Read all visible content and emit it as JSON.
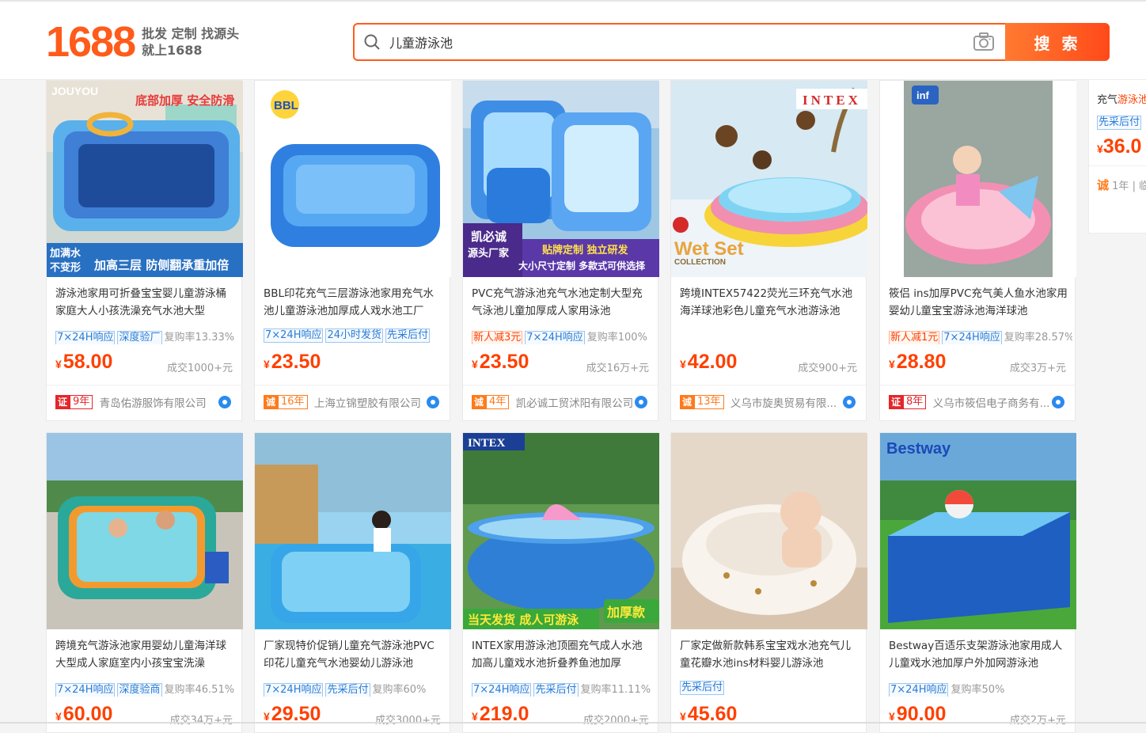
{
  "header": {
    "logo_number": "1688",
    "slogan_line1": "批发 定制 找源头",
    "slogan_line2": "就上1688",
    "search_value": "儿童游泳池",
    "search_button": "搜 索"
  },
  "products": [
    {
      "title": "游泳池家用可折叠宝宝婴儿童游泳桶家庭大人小孩洗澡充气水池大型",
      "tags": [
        {
          "text": "7×24H响应",
          "type": "blue"
        },
        {
          "text": "深度验厂",
          "type": "blue"
        }
      ],
      "repurchase": "复购率13.33%",
      "price": "58.00",
      "sales": "成交1000+元",
      "badge_icon": "证",
      "badge_type": "red",
      "years": "9年",
      "shop": "青岛佑游服饰有限公司",
      "img": "pool-stones",
      "img_caption1": "加满水",
      "img_caption2": "不变形",
      "img_caption3": "加高三层 防侧翻承重加倍",
      "img_brand": "JOUYOU",
      "img_top": "底部加厚 安全防滑"
    },
    {
      "title": "BBL印花充气三层游泳池家用充气水池儿童游泳池加厚成人戏水池工厂",
      "tags": [
        {
          "text": "7×24H响应",
          "type": "blue"
        },
        {
          "text": "24小时发货",
          "type": "blue"
        },
        {
          "text": "先采后付",
          "type": "blue"
        }
      ],
      "repurchase": "",
      "price": "23.50",
      "sales": "",
      "badge_icon": "诚",
      "badge_type": "orange",
      "years": "16年",
      "shop": "上海立锦塑胶有限公司",
      "img": "pool-blue-white",
      "img_brand": "BBL"
    },
    {
      "title": "PVC充气游泳池充气水池定制大型充气泳池儿童加厚成人家用泳池",
      "tags": [
        {
          "text": "新人减3元",
          "type": "red"
        },
        {
          "text": "7×24H响应",
          "type": "blue"
        }
      ],
      "repurchase": "复购率100%",
      "price": "23.50",
      "sales": "成交16万+元",
      "badge_icon": "诚",
      "badge_type": "orange",
      "years": "4年",
      "shop": "凯必诚工贸沭阳有限公司",
      "img": "pool-stack",
      "img_caption1": "凯必诚",
      "img_caption2": "源头厂家",
      "img_caption3": "贴牌定制 独立研发",
      "img_caption4": "大小尺寸定制 多款式可供选择"
    },
    {
      "title": "跨境INTEX57422荧光三环充气水池海洋球池彩色儿童充气水池游泳池",
      "tags": [],
      "repurchase": "",
      "price": "42.00",
      "sales": "成交900+元",
      "badge_icon": "诚",
      "badge_type": "orange",
      "years": "13年",
      "shop": "义乌市旋奥贸易有限...",
      "img": "pool-rainbow",
      "img_brand": "INTEX",
      "img_caption1": "Wet Set",
      "img_caption2": "COLLECTION"
    },
    {
      "title": "筱侣 ins加厚PVC充气美人鱼水池家用婴幼儿童宝宝游泳池海洋球池",
      "tags": [
        {
          "text": "新人减1元",
          "type": "red"
        },
        {
          "text": "7×24H响应",
          "type": "blue"
        }
      ],
      "repurchase": "复购率28.57%",
      "price": "28.80",
      "sales": "成交3万+元",
      "badge_icon": "证",
      "badge_type": "red",
      "years": "8年",
      "shop": "义乌市筱侣电子商务有...",
      "img": "pool-pink",
      "img_brand": "inf"
    },
    {
      "title": "跨境充气游泳池家用婴幼儿童海洋球大型成人家庭室内小孩宝宝洗澡",
      "tags": [
        {
          "text": "7×24H响应",
          "type": "blue"
        },
        {
          "text": "深度验商",
          "type": "blue"
        }
      ],
      "repurchase": "复购率46.51%",
      "price": "60.00",
      "sales": "成交34万+元",
      "img": "pool-orange-green"
    },
    {
      "title": "厂家现特价促销儿童充气游泳池PVC印花儿童充气水池婴幼儿游泳池",
      "tags": [
        {
          "text": "7×24H响应",
          "type": "blue"
        },
        {
          "text": "先采后付",
          "type": "blue"
        }
      ],
      "repurchase": "复购率60%",
      "price": "29.50",
      "sales": "成交3000+元",
      "img": "pool-outdoor"
    },
    {
      "title": "INTEX家用游泳池顶圈充气成人水池加高儿童戏水池折叠养鱼池加厚",
      "tags": [
        {
          "text": "7×24H响应",
          "type": "blue"
        },
        {
          "text": "先采后付",
          "type": "blue"
        }
      ],
      "repurchase": "复购率11.11%",
      "price": "219.0",
      "sales": "成交2000+元",
      "img": "pool-intex-round",
      "img_brand": "INTEX",
      "img_caption1": "当天发货 成人可游泳",
      "img_caption2": "加厚款"
    },
    {
      "title": "厂家定做新款韩系宝宝戏水池充气儿童花瓣水池ins材料婴儿游泳池",
      "tags": [
        {
          "text": "先采后付",
          "type": "blue"
        }
      ],
      "repurchase": "",
      "price": "45.60",
      "sales": "",
      "img": "pool-petal"
    },
    {
      "title": "Bestway百适乐支架游泳池家用成人儿童戏水池加厚户外加网游泳池",
      "tags": [
        {
          "text": "7×24H响应",
          "type": "blue"
        }
      ],
      "repurchase": "复购率50%",
      "price": "90.00",
      "sales": "成交2万+元",
      "img": "pool-bestway",
      "img_brand": "Bestway"
    }
  ],
  "side": {
    "title_prefix": "充气",
    "title_highlight": "游泳池",
    "tag": "先采后付",
    "price": "36.0",
    "badge": "诚",
    "years": "1年",
    "extra": "| 临"
  },
  "currency": "¥",
  "colors": {
    "accent": "#ff5b1a",
    "price": "#ff4000",
    "tag_blue": "#2a7cd6"
  }
}
